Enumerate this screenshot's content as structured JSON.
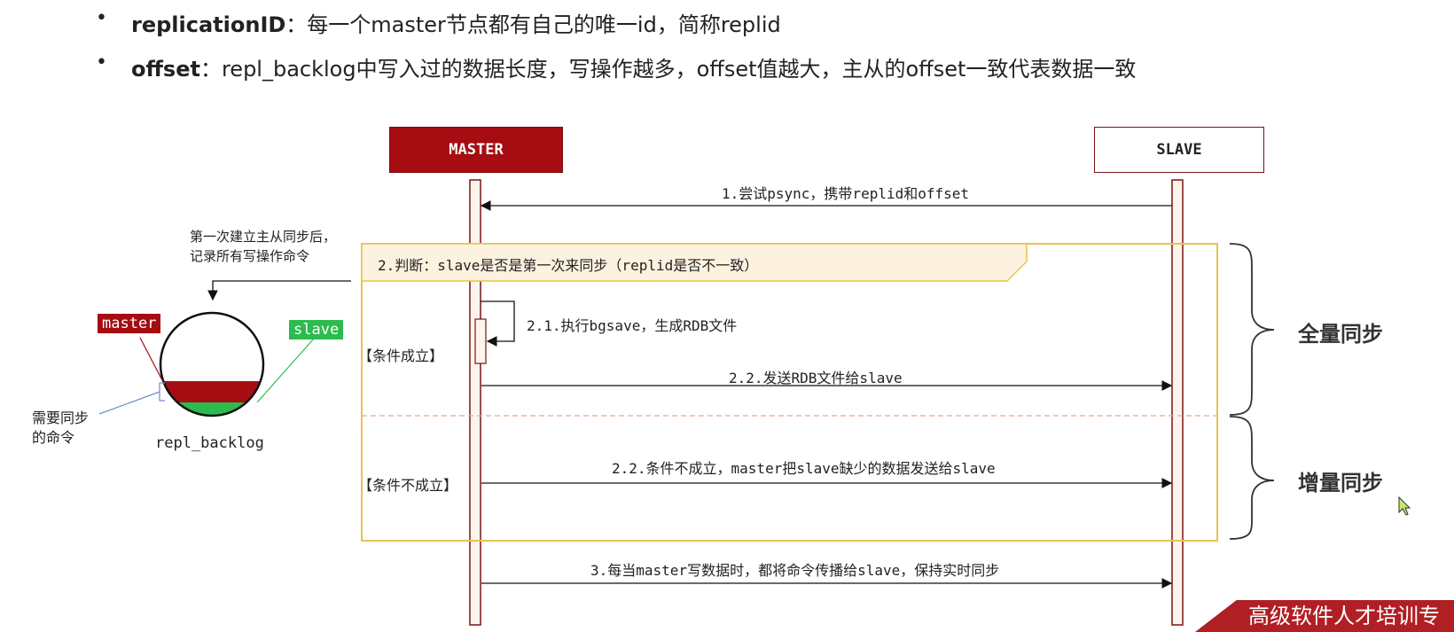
{
  "bullets": [
    {
      "term": "replicationID",
      "sep": "：",
      "text": "每一个master节点都有自己的唯一id，简称replid"
    },
    {
      "term": "offset",
      "sep": "：",
      "text": "repl_backlog中写入过的数据长度，写操作越多，offset值越大，主从的offset一致代表数据一致"
    }
  ],
  "actors": {
    "master": "MASTER",
    "slave": "SLAVE"
  },
  "messages": {
    "m1": "1.尝试psync，携带replid和offset",
    "m2": "2.判断：slave是否是第一次来同步（replid是否不一致）",
    "m21": "2.1.执行bgsave，生成RDB文件",
    "m22": "2.2.发送RDB文件给slave",
    "m22b": "2.2.条件不成立，master把slave缺少的数据发送给slave",
    "m3": "3.每当master写数据时，都将命令传播给slave，保持实时同步"
  },
  "conditions": {
    "yes": "【条件成立】",
    "no": "【条件不成立】"
  },
  "sides": {
    "full": "全量同步",
    "incremental": "增量同步"
  },
  "backlog": {
    "note_line1": "第一次建立主从同步后，",
    "note_line2": "记录所有写操作命令",
    "master_tag": "master",
    "slave_tag": "slave",
    "need_line1": "需要同步",
    "need_line2": "的命令",
    "name": "repl_backlog"
  },
  "banner": "高级软件人才培训专",
  "colors": {
    "master_red": "#a50d12",
    "slave_green": "#2cbb4f",
    "frame_yellow": "#e8c44e",
    "note_fill": "#fdf2df"
  }
}
